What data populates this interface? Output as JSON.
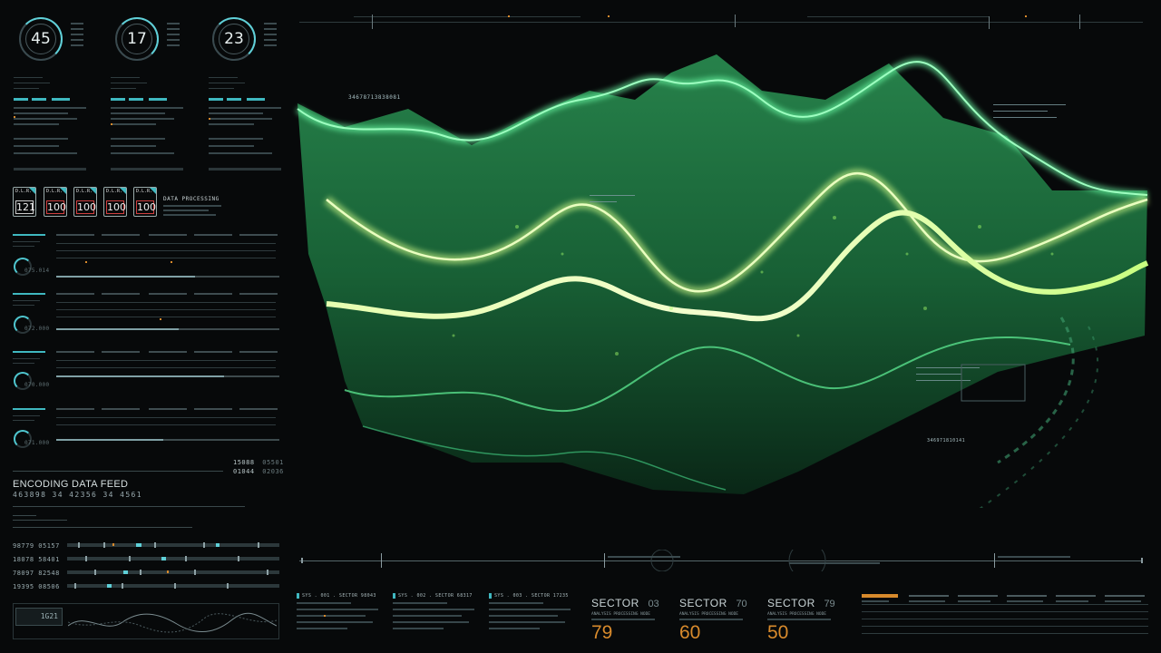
{
  "counters": [
    {
      "value": "45"
    },
    {
      "value": "17"
    },
    {
      "value": "23"
    }
  ],
  "processing": {
    "label": "DATA PROCESSING",
    "modules": [
      {
        "head": "D.L.R.",
        "value": "121",
        "state": "normal"
      },
      {
        "head": "D.L.R.",
        "value": "100",
        "state": "alert"
      },
      {
        "head": "D.L.R.",
        "value": "100",
        "state": "alert"
      },
      {
        "head": "D.L.R.",
        "value": "100",
        "state": "alert"
      },
      {
        "head": "D.L.R.",
        "value": "100",
        "state": "alert"
      }
    ]
  },
  "gauges": [
    {
      "label": "075.014",
      "level": 0.62
    },
    {
      "label": "072.000",
      "level": 0.55
    },
    {
      "label": "070.000",
      "level": 0.75
    },
    {
      "label": "071.000",
      "level": 0.48
    }
  ],
  "readout": {
    "row1": [
      "15088",
      "05501"
    ],
    "row2": [
      "01044",
      "02036"
    ]
  },
  "encoding": {
    "title": "ENCODING DATA FEED",
    "values": "463898 34 42356 34 4561",
    "rows": [
      "98779 05157",
      "18078 58401",
      "78097 82548",
      "19395 08506"
    ]
  },
  "footer_left": {
    "code": "1G21"
  },
  "visual": {
    "id_label": "34678713838081",
    "id_label_2": "346971810141"
  },
  "systems": [
    {
      "label": "SYS . 001 . SECTOR 98043"
    },
    {
      "label": "SYS . 002 . SECTOR 68317"
    },
    {
      "label": "SYS . 003 . SECTOR 17235"
    }
  ],
  "sectors": [
    {
      "label": "SECTOR",
      "code": "03",
      "caption": "ANALYSIS PROCESSING NODE",
      "value": "79"
    },
    {
      "label": "SECTOR",
      "code": "70",
      "caption": "ANALYSIS PROCESSING NODE",
      "value": "60"
    },
    {
      "label": "SECTOR",
      "code": "79",
      "caption": "ANALYSIS PROCESSING NODE",
      "value": "50"
    }
  ],
  "colors": {
    "accent": "#3fb8c0",
    "terrain_bright": "#b8ff6a",
    "terrain_mid": "#2fcf7a",
    "alert": "#d04040",
    "orange": "#d88a2c"
  }
}
